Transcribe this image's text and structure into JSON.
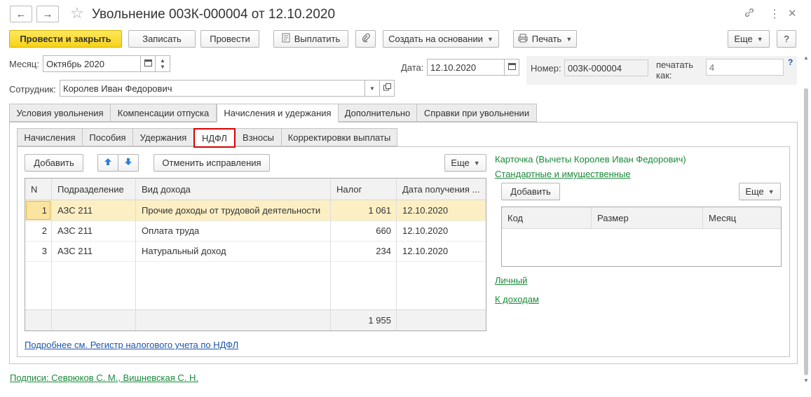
{
  "window": {
    "title": "Увольнение 003К-000004 от 12.10.2020",
    "back_icon": "←",
    "forward_icon": "→",
    "star_icon": "☆",
    "link_icon": "🔗",
    "more_icon": "⋮",
    "close_icon": "✕"
  },
  "toolbar": {
    "post_close": "Провести и закрыть",
    "save": "Записать",
    "post": "Провести",
    "pay": "Выплатить",
    "create_based": "Создать на основании",
    "print": "Печать",
    "more": "Еще",
    "help": "?"
  },
  "header": {
    "month_label": "Месяц:",
    "month_value": "Октябрь 2020",
    "date_label": "Дата:",
    "date_value": "12.10.2020",
    "number_label": "Номер:",
    "number_value": "003К-000004",
    "print_as_label": "печатать как:",
    "print_as_placeholder": "4",
    "help_mark": "?",
    "employee_label": "Сотрудник:",
    "employee_value": "Королев Иван Федорович"
  },
  "tabs": [
    {
      "label": "Условия увольнения"
    },
    {
      "label": "Компенсации отпуска"
    },
    {
      "label": "Начисления и удержания"
    },
    {
      "label": "Дополнительно"
    },
    {
      "label": "Справки при увольнении"
    }
  ],
  "subtabs": [
    {
      "label": "Начисления"
    },
    {
      "label": "Пособия"
    },
    {
      "label": "Удержания"
    },
    {
      "label": "НДФЛ"
    },
    {
      "label": "Взносы"
    },
    {
      "label": "Корректировки выплаты"
    }
  ],
  "ndfl": {
    "add": "Добавить",
    "cancel_corrections": "Отменить исправления",
    "more": "Еще",
    "columns": [
      "N",
      "Подразделение",
      "Вид дохода",
      "Налог",
      "Дата получения ..."
    ],
    "rows": [
      {
        "n": "1",
        "dept": "АЗС 211",
        "income": "Прочие доходы от трудовой деятельности",
        "tax": "1 061",
        "date": "12.10.2020"
      },
      {
        "n": "2",
        "dept": "АЗС 211",
        "income": "Оплата труда",
        "tax": "660",
        "date": "12.10.2020"
      },
      {
        "n": "3",
        "dept": "АЗС 211",
        "income": "Натуральный доход",
        "tax": "234",
        "date": "12.10.2020"
      }
    ],
    "total_tax": "1 955",
    "register_link": "Подробнее см. Регистр налогового учета по НДФЛ"
  },
  "card": {
    "title": "Карточка (Вычеты Королев Иван Федорович)",
    "standard_link": "Стандартные и имущественные",
    "add": "Добавить",
    "more": "Еще",
    "columns": [
      "Код",
      "Размер",
      "Месяц"
    ],
    "personal_link": "Личный",
    "income_link": "К доходам"
  },
  "footer": {
    "signatures": "Подписи: Севрюков С. М., Вишневская С. Н."
  }
}
